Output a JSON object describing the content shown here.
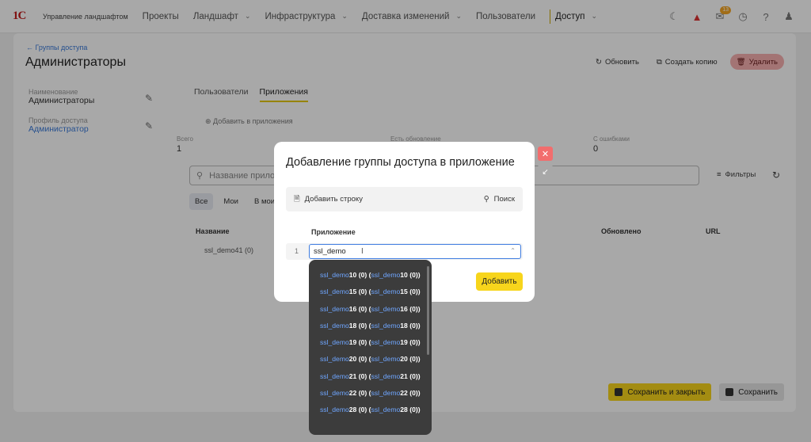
{
  "app": {
    "logo": "1С",
    "name": "Управление ландшафтом"
  },
  "nav": [
    {
      "label": "Проекты",
      "chevron": false,
      "active": false
    },
    {
      "label": "Ландшафт",
      "chevron": true,
      "active": false
    },
    {
      "label": "Инфраструктура",
      "chevron": true,
      "active": false
    },
    {
      "label": "Доставка изменений",
      "chevron": true,
      "active": false
    },
    {
      "label": "Пользователи",
      "chevron": false,
      "active": false
    },
    {
      "label": "Доступ",
      "chevron": true,
      "active": true
    }
  ],
  "top_icons": {
    "notifications_count": "13"
  },
  "page": {
    "back_link": "← Группы доступа",
    "title": "Администраторы",
    "actions": {
      "refresh": "Обновить",
      "copy": "Создать копию",
      "delete": "Удалить"
    },
    "name_label": "Наименование",
    "name_value": "Администраторы",
    "profile_label": "Профиль доступа",
    "profile_value": "Администратор",
    "tabs": [
      "Пользователи",
      "Приложения"
    ],
    "add_app": "Добавить в приложения",
    "stats": [
      {
        "label": "Всего",
        "value": "1"
      },
      {
        "label": "Есть обновление",
        "value": ""
      },
      {
        "label": "С ошибками",
        "value": "0"
      }
    ],
    "search_placeholder": "Название приложения",
    "filters": "Фильтры",
    "chips": [
      "Все",
      "Мои",
      "В моих"
    ],
    "columns": {
      "name": "Название",
      "updated": "Обновлено",
      "url": "URL"
    },
    "row": {
      "name": "ssl_demo41 (0)"
    },
    "save_close": "Сохранить и закрыть",
    "save": "Сохранить"
  },
  "modal": {
    "title": "Добавление группы доступа в приложение",
    "add_row": "Добавить строку",
    "search": "Поиск",
    "column": "Приложение",
    "row_number": "1",
    "combo_value": "ssl_demo",
    "submit": "Добавить"
  },
  "dropdown": {
    "items": [
      {
        "prefix": "ssl_demo",
        "num": "10",
        "rest": " (0) (",
        "prefix2": "ssl_demo",
        "num2": "10 (0))"
      },
      {
        "prefix": "ssl_demo",
        "num": "15",
        "rest": " (0) (",
        "prefix2": "ssl_demo",
        "num2": "15 (0))"
      },
      {
        "prefix": "ssl_demo",
        "num": "16",
        "rest": " (0) (",
        "prefix2": "ssl_demo",
        "num2": "16 (0))"
      },
      {
        "prefix": "ssl_demo",
        "num": "18",
        "rest": " (0) (",
        "prefix2": "ssl_demo",
        "num2": "18 (0))"
      },
      {
        "prefix": "ssl_demo",
        "num": "19",
        "rest": " (0) (",
        "prefix2": "ssl_demo",
        "num2": "19 (0))"
      },
      {
        "prefix": "ssl_demo",
        "num": "20",
        "rest": " (0) (",
        "prefix2": "ssl_demo",
        "num2": "20 (0))"
      },
      {
        "prefix": "ssl_demo",
        "num": "21",
        "rest": " (0) (",
        "prefix2": "ssl_demo",
        "num2": "21 (0))"
      },
      {
        "prefix": "ssl_demo",
        "num": "22",
        "rest": " (0) (",
        "prefix2": "ssl_demo",
        "num2": "22 (0))"
      },
      {
        "prefix": "ssl_demo",
        "num": "28",
        "rest": " (0) (",
        "prefix2": "ssl_demo",
        "num2": "28 (0))"
      }
    ]
  },
  "colors": {
    "accent": "#f7d51c",
    "link": "#3a7ad8",
    "danger": "#f26d6d",
    "dropdown_bg": "#3c3c3c"
  }
}
